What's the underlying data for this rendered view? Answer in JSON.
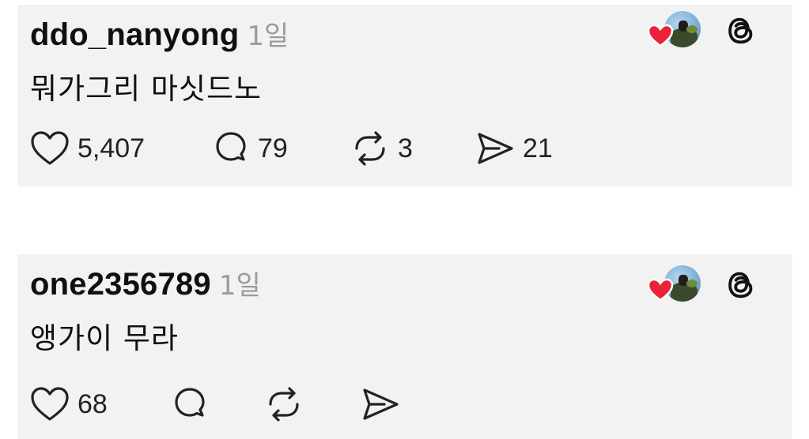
{
  "posts": [
    {
      "username": "ddo_nanyong",
      "time": "1일",
      "text": "뭐가그리 마싯드노",
      "likes": "5,407",
      "replies": "79",
      "reposts": "3",
      "shares": "21"
    },
    {
      "username": "one2356789",
      "time": "1일",
      "text": "앵가이 무라",
      "likes": "68",
      "replies": "",
      "reposts": "",
      "shares": ""
    }
  ],
  "colors": {
    "card_bg": "#f2f2f2",
    "heart_badge": "#e8233a",
    "muted_text": "#9b9b9b"
  },
  "icons": [
    "heart-icon",
    "reply-icon",
    "repost-icon",
    "share-icon",
    "threads-icon",
    "liked-heart-icon"
  ]
}
